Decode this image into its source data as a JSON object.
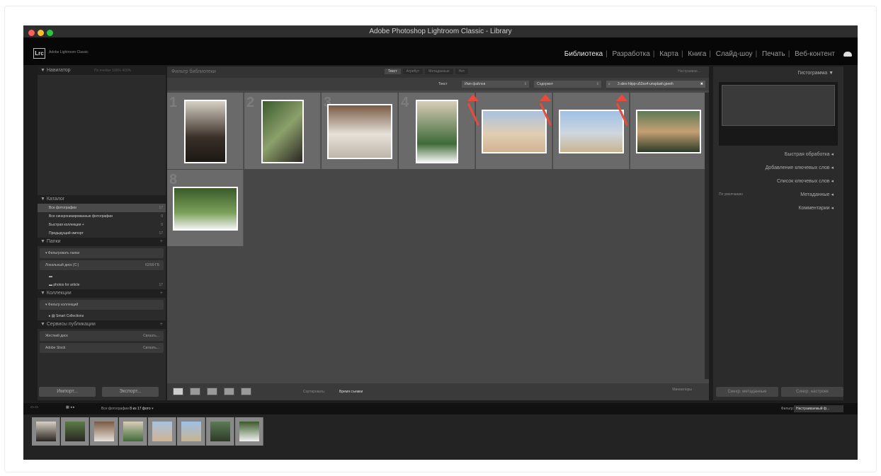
{
  "window": {
    "title": "Adobe Photoshop Lightroom Classic - Library"
  },
  "identity": {
    "logo": "Lrc",
    "app_name": "Adobe Lightroom Classic"
  },
  "modules": [
    "Библиотека",
    "Разработка",
    "Карта",
    "Книга",
    "Слайд-шоу",
    "Печать",
    "Веб-контент"
  ],
  "left_panel": {
    "navigator": "Навигатор",
    "navigator_options": [
      "По ячейке",
      "100%",
      "400%"
    ],
    "catalog": {
      "title": "Каталог",
      "items": [
        {
          "label": "Все фотографии",
          "count": "17"
        },
        {
          "label": "Все синхронизированные фотографии",
          "count": "0"
        },
        {
          "label": "Быстрая коллекция +",
          "count": "0"
        },
        {
          "label": "Предыдущий импорт",
          "count": "17"
        }
      ]
    },
    "folders": {
      "title": "Папки",
      "filter": "Фильтровать папки",
      "disk": "Локальный диск (C:)",
      "disk_space": "62/99 ГБ",
      "folder": "photos for article",
      "folder_count": "17"
    },
    "collections": {
      "title": "Коллекции",
      "filter": "Фильтр коллекций",
      "smart": "Smart Collections"
    },
    "publish": {
      "title": "Сервисы публикации",
      "services": [
        {
          "label": "Жесткий диск",
          "action": "Связать..."
        },
        {
          "label": "Adobe Stock",
          "action": "Связать..."
        }
      ]
    },
    "import_btn": "Импорт...",
    "export_btn": "Экспорт..."
  },
  "filter_bar": {
    "title": "Фильтр библиотеки",
    "tabs": [
      "Текст",
      "Атрибут",
      "Метаданные",
      "Нет"
    ],
    "presets": "Настраивае..."
  },
  "text_bar": {
    "label": "Текст",
    "field": "Имя файлов",
    "rule": "Содержит",
    "search_value": "3 alex-hlipp-u53ss4-unsplash.jpeeh"
  },
  "grid": {
    "numbers": [
      "1",
      "2",
      "3",
      "4",
      "8"
    ]
  },
  "toolbar": {
    "sort_label": "Сортировать:",
    "sort_value": "Время съемки",
    "thumbs_label": "Миниатюры"
  },
  "right_panel": {
    "histogram": "Гистограмма",
    "quick_develop": "Быстрая обработка",
    "add_keywords": "Добавление ключевых слов",
    "keyword_list": "Список ключевых слов",
    "metadata": "Метаданные",
    "metadata_preset": "По умолчанию",
    "comments": "Комментарии",
    "sync_meta": "Синхр. метаданные",
    "sync_settings": "Синхр. настроек"
  },
  "filmstrip": {
    "source": "Все фотографии",
    "count": "8 из 17 фото",
    "filter_label": "Фильтр:",
    "filter_value": "Настраиваемый ф..."
  },
  "colors": {
    "accent_arrow": "#e84a3c",
    "panel": "#2b2b2b",
    "grid": "#474747"
  }
}
